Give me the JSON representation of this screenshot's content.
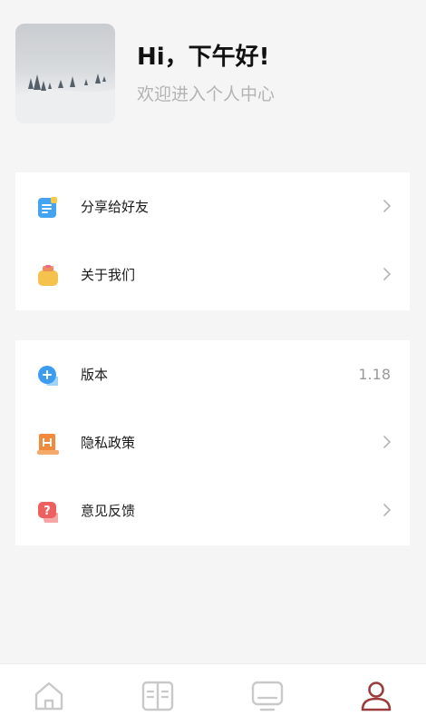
{
  "header": {
    "greeting": "Hi，下午好!",
    "subtitle": "欢迎进入个人中心"
  },
  "menu_group_1": [
    {
      "label": "分享给好友",
      "icon": "share-book-icon"
    },
    {
      "label": "关于我们",
      "icon": "about-bag-icon"
    }
  ],
  "menu_group_2": [
    {
      "label": "版本",
      "icon": "version-plus-icon",
      "value": "1.18"
    },
    {
      "label": "隐私政策",
      "icon": "privacy-h-icon"
    },
    {
      "label": "意见反馈",
      "icon": "feedback-question-icon"
    }
  ],
  "tabbar": {
    "tabs": [
      {
        "icon": "home-icon",
        "active": false
      },
      {
        "icon": "book-icon",
        "active": false
      },
      {
        "icon": "monitor-icon",
        "active": false
      },
      {
        "icon": "user-icon",
        "active": true
      }
    ],
    "active_color": "#9c3b3b",
    "inactive_color": "#c9c9c9"
  }
}
